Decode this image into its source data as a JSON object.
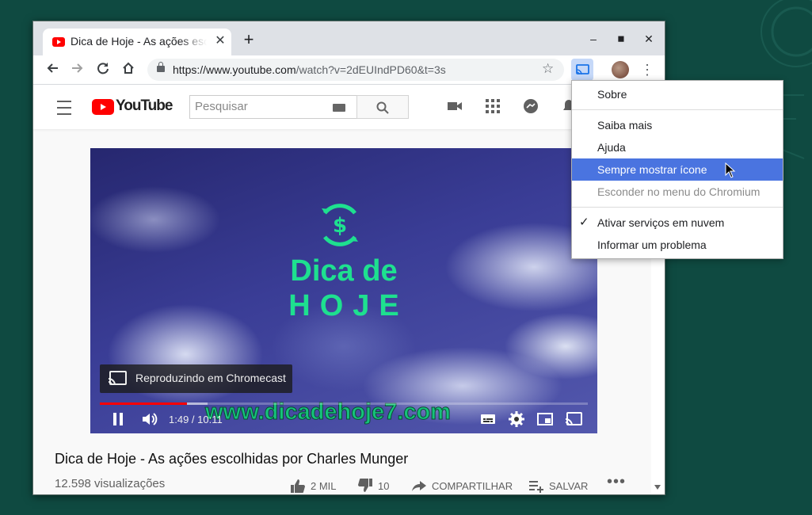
{
  "browser": {
    "tab_title": "Dica de Hoje - As ações escolhidas por Charles Munger",
    "url_host": "https://www.youtube.com",
    "url_path": "/watch?v=2dEUIndPD60&t=3s"
  },
  "youtube": {
    "logo_text": "YouTube",
    "search_placeholder": "Pesquisar"
  },
  "player": {
    "brand_line1": "Dica de",
    "brand_line2": "HOJE",
    "watermark": "www.dicadehoje7.com",
    "cast_status": "Reproduzindo em Chromecast",
    "time_current": "1:49",
    "time_total": "10:11",
    "time_display": "1:49 / 10:11",
    "progress_fraction": 0.178
  },
  "video": {
    "title": "Dica de Hoje - As ações escolhidas por Charles Munger",
    "views": "12.598 visualizações",
    "likes": "2 MIL",
    "dislikes": "10",
    "share_label": "COMPARTILHAR",
    "save_label": "SALVAR"
  },
  "context_menu": {
    "items": [
      {
        "label": "Sobre"
      },
      {
        "label": "Saiba mais"
      },
      {
        "label": "Ajuda"
      },
      {
        "label": "Sempre mostrar ícone",
        "highlighted": true
      },
      {
        "label": "Esconder no menu do Chromium",
        "disabled": true
      },
      {
        "label": "Ativar serviços em nuvem",
        "checked": true
      },
      {
        "label": "Informar um problema"
      }
    ]
  },
  "colors": {
    "desktop_bg": "#0f4a41",
    "menu_highlight": "#4a74e0",
    "brand_green": "#1ee08f",
    "youtube_red": "#ff0000"
  }
}
